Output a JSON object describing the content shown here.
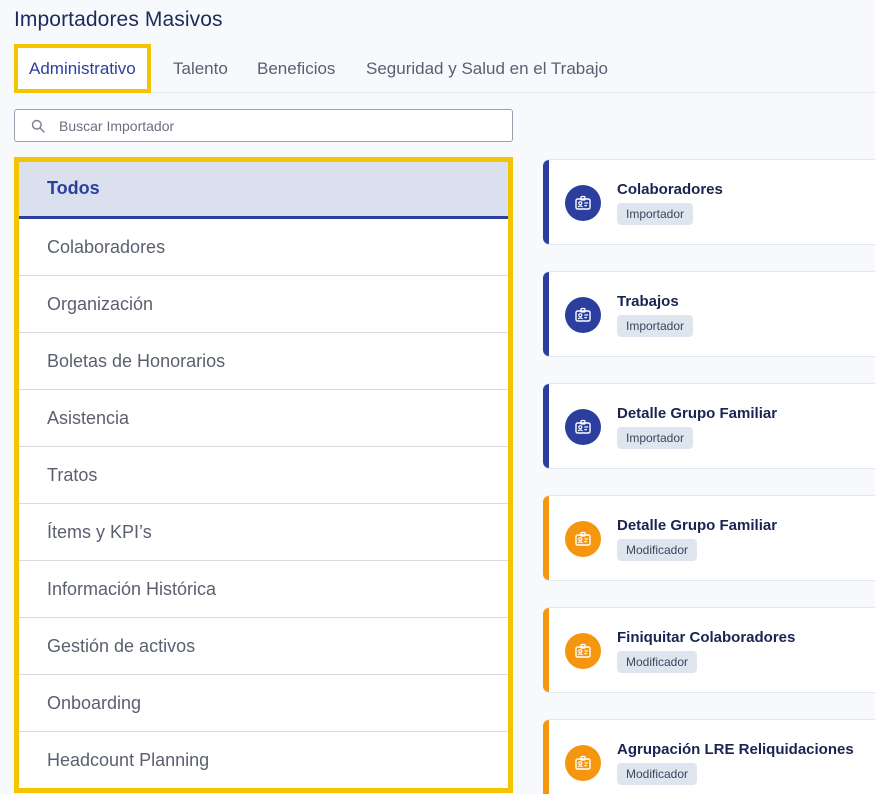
{
  "header": {
    "title": "Importadores Masivos"
  },
  "tabs": [
    {
      "label": "Administrativo",
      "active": true
    },
    {
      "label": "Talento"
    },
    {
      "label": "Beneficios"
    },
    {
      "label": "Seguridad y Salud en el Trabajo"
    }
  ],
  "search": {
    "placeholder": "Buscar Importador",
    "value": "",
    "icon": "search-icon"
  },
  "categories": [
    {
      "label": "Todos",
      "active": true
    },
    {
      "label": "Colaboradores"
    },
    {
      "label": "Organización"
    },
    {
      "label": "Boletas de Honorarios"
    },
    {
      "label": "Asistencia"
    },
    {
      "label": "Tratos"
    },
    {
      "label": "Ítems y KPI’s"
    },
    {
      "label": "Información Histórica"
    },
    {
      "label": "Gestión de activos"
    },
    {
      "label": "Onboarding"
    },
    {
      "label": "Headcount Planning"
    }
  ],
  "cards": [
    {
      "title": "Colaboradores",
      "badge": "Importador",
      "kind": "importador",
      "icon": "id-card-icon"
    },
    {
      "title": "Trabajos",
      "badge": "Importador",
      "kind": "importador",
      "icon": "id-card-icon"
    },
    {
      "title": "Detalle Grupo Familiar",
      "badge": "Importador",
      "kind": "importador",
      "icon": "id-card-icon"
    },
    {
      "title": "Detalle Grupo Familiar",
      "badge": "Modificador",
      "kind": "modificador",
      "icon": "id-card-icon"
    },
    {
      "title": "Finiquitar Colaboradores",
      "badge": "Modificador",
      "kind": "modificador",
      "icon": "id-card-icon"
    },
    {
      "title": "Agrupación LRE Reliquidaciones",
      "badge": "Modificador",
      "kind": "modificador",
      "icon": "id-card-icon"
    }
  ],
  "colors": {
    "importador": "#2c3f9e",
    "modificador": "#f5960f",
    "highlight": "#f5c400"
  }
}
